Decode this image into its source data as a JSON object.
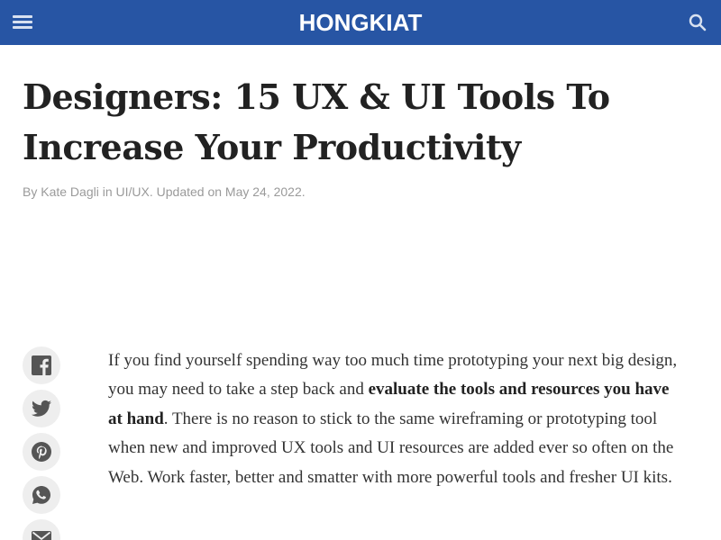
{
  "header": {
    "logo_text": "HONGKIAT",
    "background_color": "#2755a4",
    "menu_icon": "hamburger-menu-icon",
    "search_icon": "search-icon"
  },
  "article": {
    "title_line1": "Designers: 15 UX & UI Tools To",
    "title_line2": "Increase Your Productivity",
    "byline": {
      "prefix": "By",
      "author": "Kate Dagli",
      "in_text": "in",
      "category": "UI/UX",
      "updated_text": ". Updated on May 24, 2022."
    },
    "intro": {
      "part1": "If you find yourself spending way too much time prototyping your next big design, you may need to take a step back and ",
      "bold": "evaluate the tools and resources you have at hand",
      "part2": ". There is no reason to stick to the same wireframing or prototyping tool when new and improved UX tools and UI resources are added ever so often on the Web. Work faster, better and smatter with more powerful tools and fresher UI kits."
    }
  },
  "share": {
    "buttons": [
      {
        "name": "facebook",
        "icon": "facebook-icon"
      },
      {
        "name": "twitter",
        "icon": "twitter-icon"
      },
      {
        "name": "pinterest",
        "icon": "pinterest-icon"
      },
      {
        "name": "whatsapp",
        "icon": "whatsapp-icon"
      },
      {
        "name": "email",
        "icon": "email-icon"
      }
    ],
    "icon_color": "#555555"
  }
}
